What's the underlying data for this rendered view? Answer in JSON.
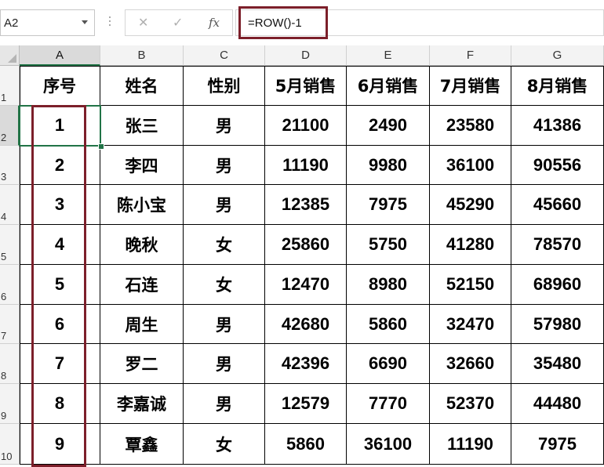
{
  "formula_bar": {
    "name_box": "A2",
    "cancel_glyph": "✕",
    "enter_glyph": "✓",
    "fx_glyph": "fx",
    "formula": "=ROW()-1"
  },
  "column_headers": [
    "A",
    "B",
    "C",
    "D",
    "E",
    "F",
    "G"
  ],
  "row_headers": [
    "1",
    "2",
    "3",
    "4",
    "5",
    "6",
    "7",
    "8",
    "9",
    "10"
  ],
  "table": {
    "headers": [
      "序号",
      "姓名",
      "性别",
      "5月销售",
      "6月销售",
      "7月销售",
      "8月销售"
    ],
    "rows": [
      [
        "1",
        "张三",
        "男",
        "21100",
        "2490",
        "23580",
        "41386"
      ],
      [
        "2",
        "李四",
        "男",
        "11190",
        "9980",
        "36100",
        "90556"
      ],
      [
        "3",
        "陈小宝",
        "男",
        "12385",
        "7975",
        "45290",
        "45660"
      ],
      [
        "4",
        "晚秋",
        "女",
        "25860",
        "5750",
        "41280",
        "78570"
      ],
      [
        "5",
        "石连",
        "女",
        "12470",
        "8980",
        "52150",
        "68960"
      ],
      [
        "6",
        "周生",
        "男",
        "42680",
        "5860",
        "32470",
        "57980"
      ],
      [
        "7",
        "罗二",
        "男",
        "42396",
        "6690",
        "32660",
        "35480"
      ],
      [
        "8",
        "李嘉诚",
        "男",
        "12579",
        "7770",
        "52370",
        "44480"
      ],
      [
        "9",
        "覃鑫",
        "女",
        "5860",
        "36100",
        "11190",
        "7975"
      ]
    ]
  },
  "colors": {
    "highlight": "#7c1f2a",
    "selection": "#217346"
  }
}
